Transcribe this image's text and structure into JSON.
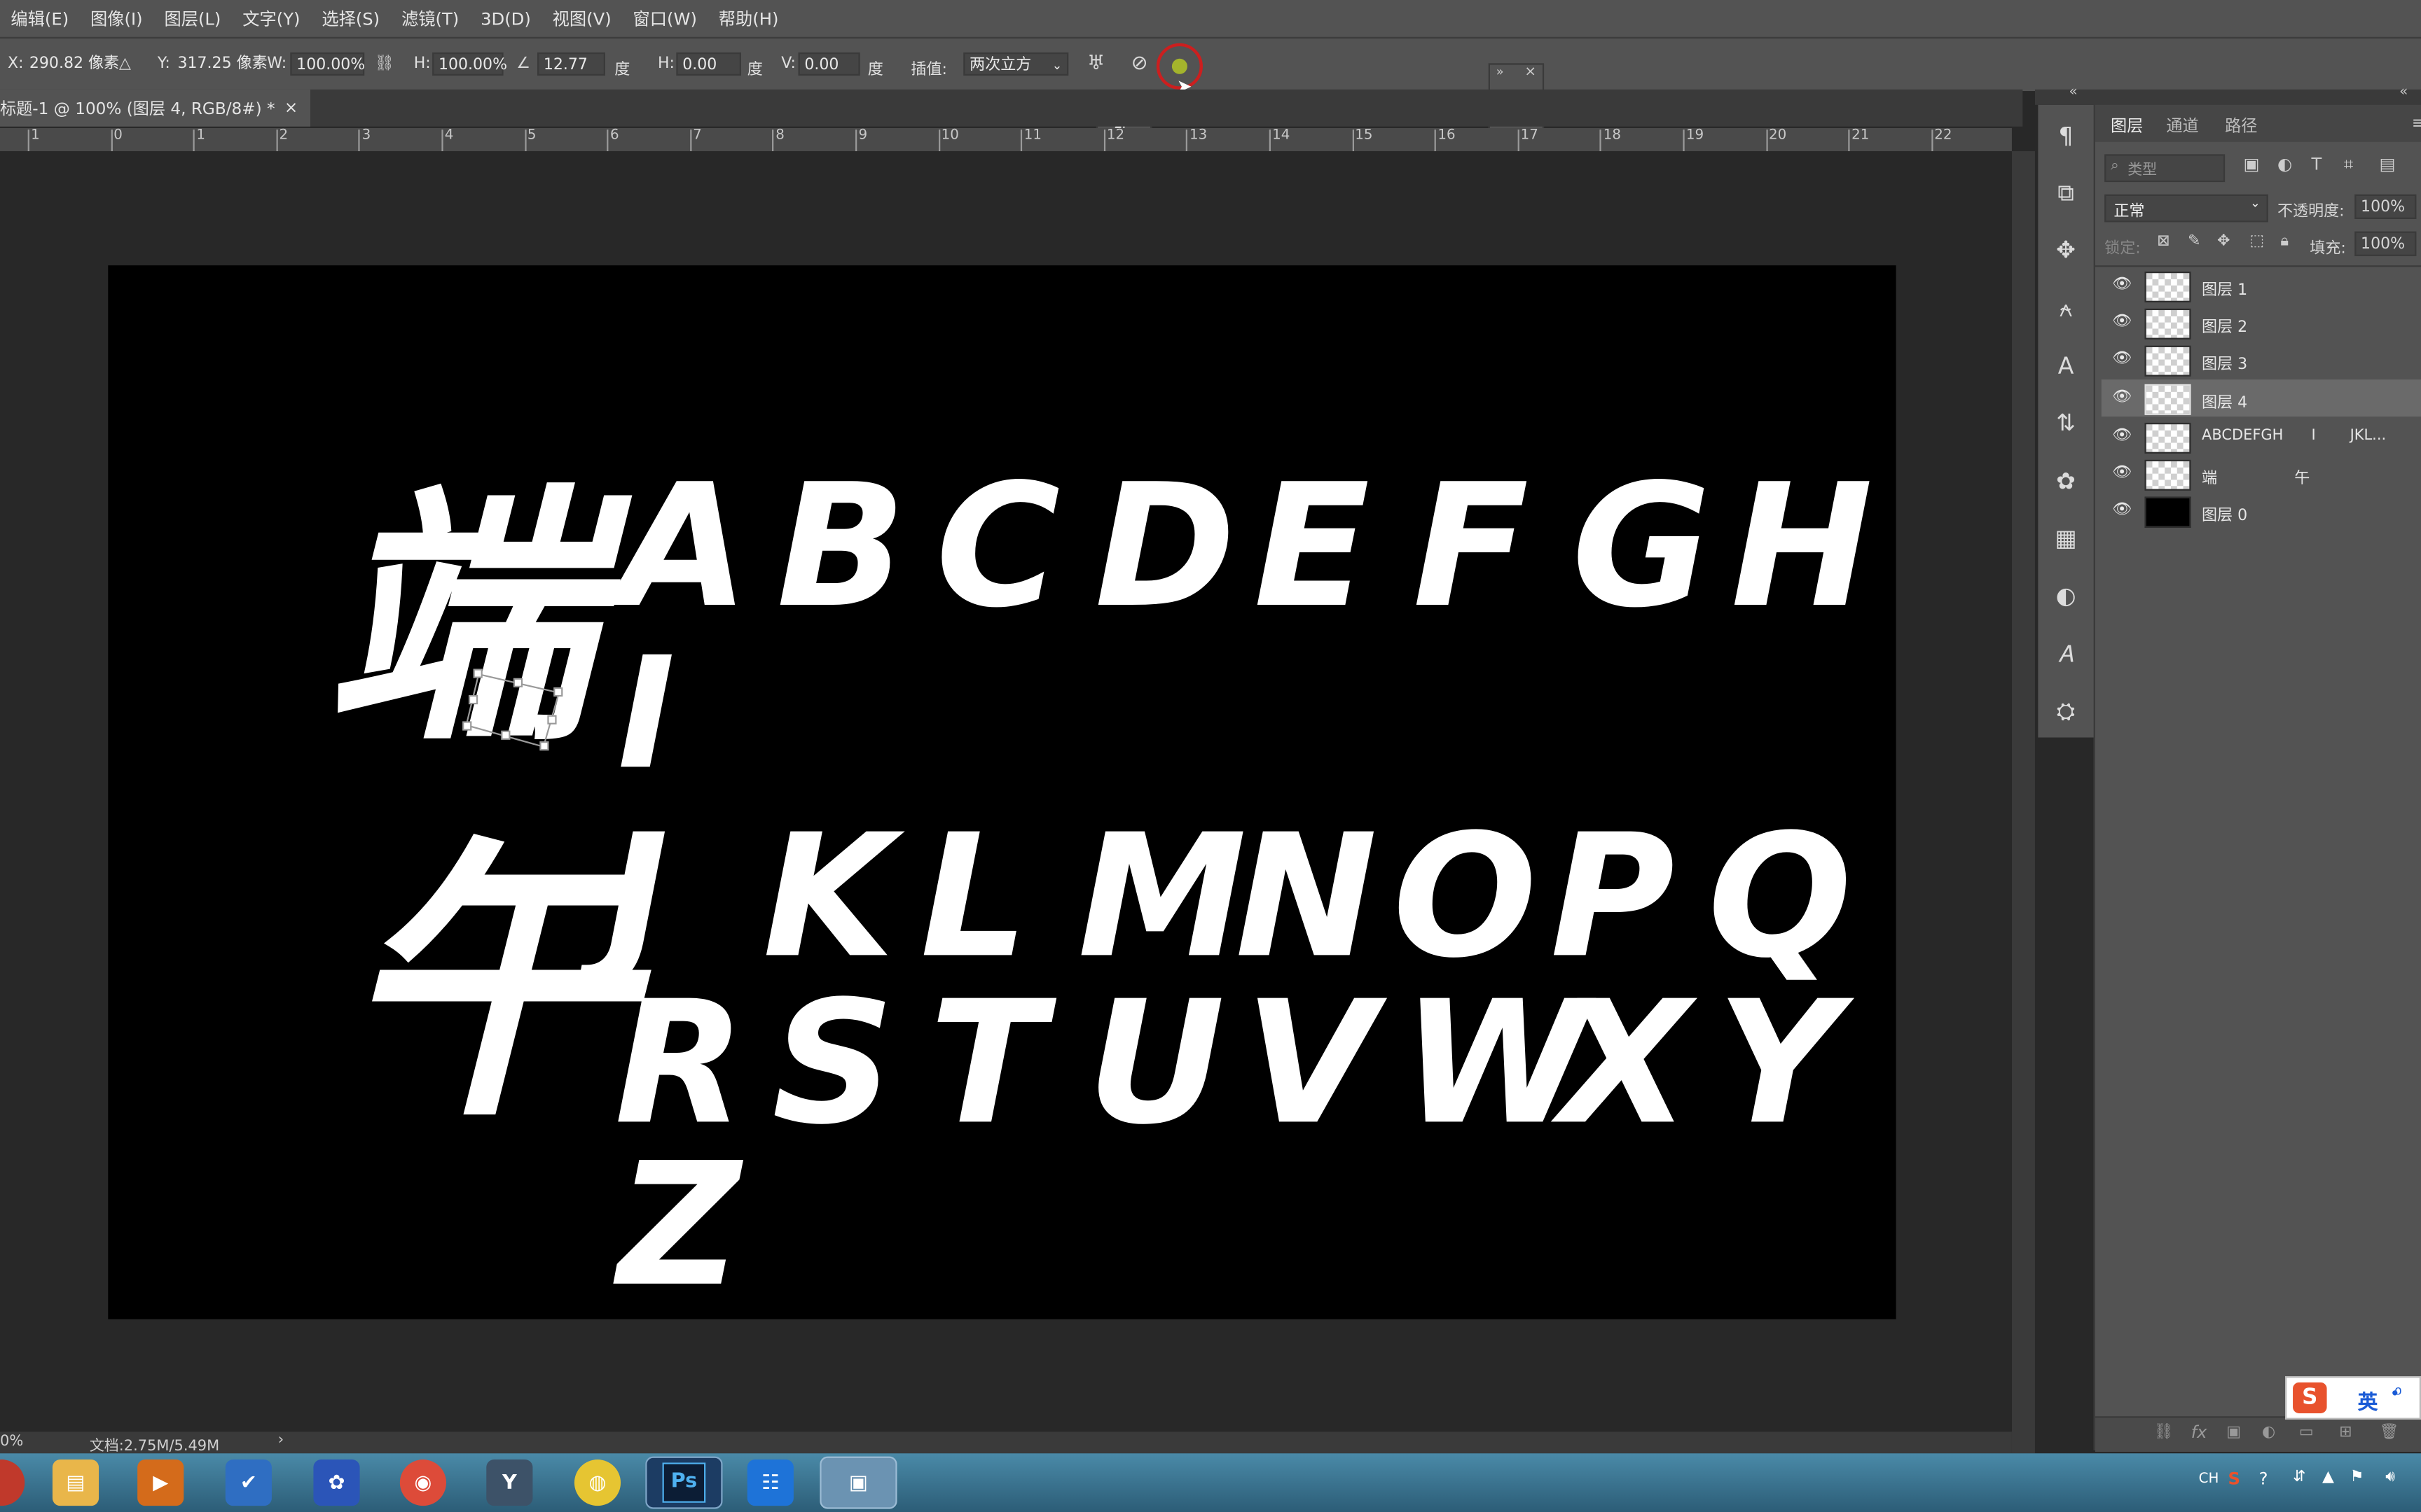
{
  "menu": [
    "编辑(E)",
    "图像(I)",
    "图层(L)",
    "文字(Y)",
    "选择(S)",
    "滤镜(T)",
    "3D(D)",
    "视图(V)",
    "窗口(W)",
    "帮助(H)"
  ],
  "options": {
    "x_label": "X:",
    "x_value": "290.82 像素",
    "y_label": "Y:",
    "y_value": "317.25 像素",
    "w_label": "W:",
    "w_value": "100.00%",
    "h_label": "H:",
    "h_value": "100.00%",
    "angle_value": "12.77",
    "angle_unit": "度",
    "hskew_label": "H:",
    "hskew_value": "0.00",
    "hskew_unit": "度",
    "vskew_label": "V:",
    "vskew_value": "0.00",
    "vskew_unit": "度",
    "interp_label": "插值:",
    "interp_value": "两次立方"
  },
  "document_tab": {
    "title": "标题-1 @ 100% (图层 4, RGB/8#) *",
    "close": "×"
  },
  "ruler_ticks": [
    "1",
    "0",
    "1",
    "2",
    "3",
    "4",
    "5",
    "6",
    "7",
    "8",
    "9",
    "10",
    "11",
    "12",
    "13",
    "14",
    "15",
    "16",
    "17",
    "18",
    "19",
    "20",
    "21",
    "22"
  ],
  "canvas": {
    "char_duan": "端",
    "char_wu": "午",
    "row1": [
      "A",
      "B",
      "C",
      "D",
      "E",
      "F",
      "G",
      "H"
    ],
    "row1b": "I",
    "row2": [
      "J",
      "K",
      "L",
      "M",
      "N",
      "O",
      "P",
      "Q"
    ],
    "row3": [
      "R",
      "S",
      "T",
      "U",
      "V",
      "W",
      "X",
      "Y"
    ],
    "row4": "Z"
  },
  "status": {
    "zoom": "0%",
    "doc": "文档:2.75M/5.49M",
    "arrow": "›"
  },
  "panel": {
    "tabs": [
      "图层",
      "通道",
      "路径"
    ],
    "search_placeholder": "类型",
    "blend_mode": "正常",
    "opacity_label": "不透明度:",
    "opacity_value": "100%",
    "lock_label": "锁定:",
    "fill_label": "填充:",
    "fill_value": "100%",
    "layers": [
      {
        "name": "图层 1",
        "selected": false,
        "thumb": "transparent"
      },
      {
        "name": "图层 2",
        "selected": false,
        "thumb": "transparent"
      },
      {
        "name": "图层 3",
        "selected": false,
        "thumb": "transparent"
      },
      {
        "name": "图层 4",
        "selected": true,
        "thumb": "transparent"
      },
      {
        "name": "ABCDEFGH",
        "extra": "I",
        "extra2": "JKL...",
        "selected": false,
        "thumb": "transparent"
      },
      {
        "name": "端",
        "extra": "午",
        "selected": false,
        "thumb": "transparent"
      },
      {
        "name": "图层 0",
        "selected": false,
        "thumb": "black"
      }
    ]
  },
  "ime": {
    "label": "英"
  },
  "taskbar": {
    "ps_label": "Ps",
    "tray_lang": "CH"
  },
  "icons": [
    "pilcrow-icon",
    "warp-icon",
    "cancel-icon",
    "commit-icon",
    "chevron-down-icon",
    "eye-icon",
    "lock-icon",
    "link-icon",
    "angle-icon"
  ],
  "colors": {
    "canvas_bg": "#000000",
    "letters": "#ffffff",
    "ui_bg": "#535353",
    "workspace": "#282828",
    "commit_highlight": "#cc1f1f"
  }
}
